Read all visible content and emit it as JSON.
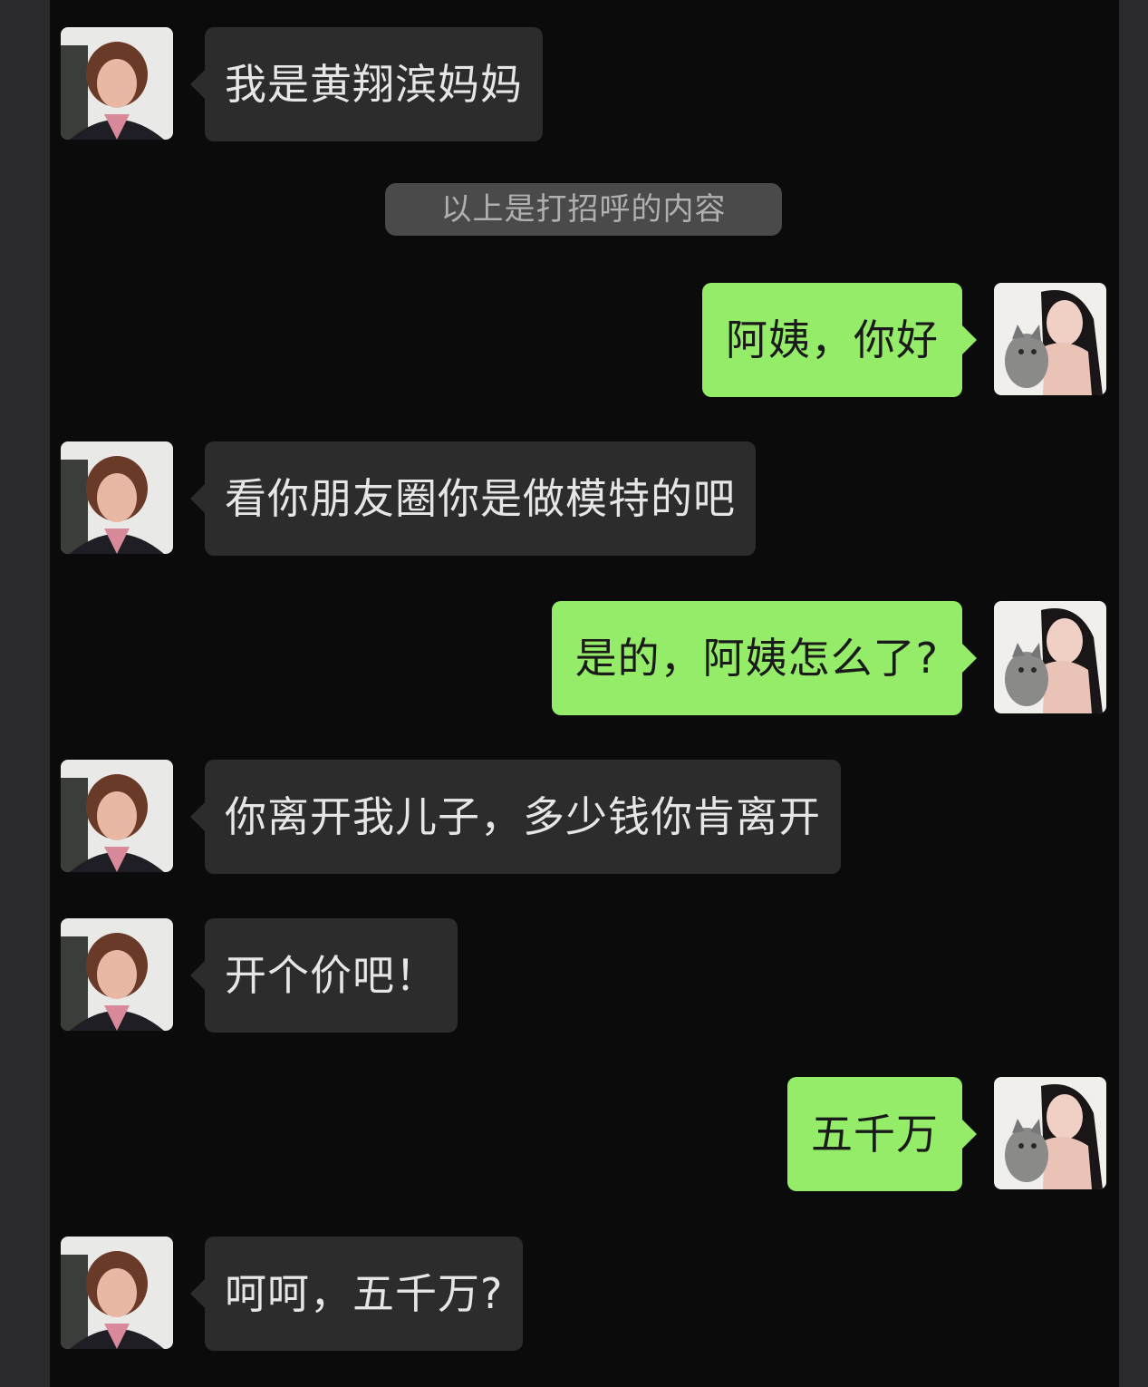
{
  "colors": {
    "background": "#0b0b0b",
    "incoming_bubble": "#2c2c2c",
    "outgoing_bubble": "#95ec69",
    "system_notice": "#4a4a4a"
  },
  "system_notice": "以上是打招呼的内容",
  "messages": [
    {
      "sender": "mother",
      "text": "我是黄翔滨妈妈"
    },
    {
      "sender": "self",
      "text": "阿姨，你好"
    },
    {
      "sender": "mother",
      "text": "看你朋友圈你是做模特的吧"
    },
    {
      "sender": "self",
      "text": "是的，阿姨怎么了?"
    },
    {
      "sender": "mother",
      "text": "你离开我儿子，多少钱你肯离开"
    },
    {
      "sender": "mother",
      "text": "开个价吧！"
    },
    {
      "sender": "self",
      "text": "五千万"
    },
    {
      "sender": "mother",
      "text": "呵呵，五千万?"
    }
  ]
}
